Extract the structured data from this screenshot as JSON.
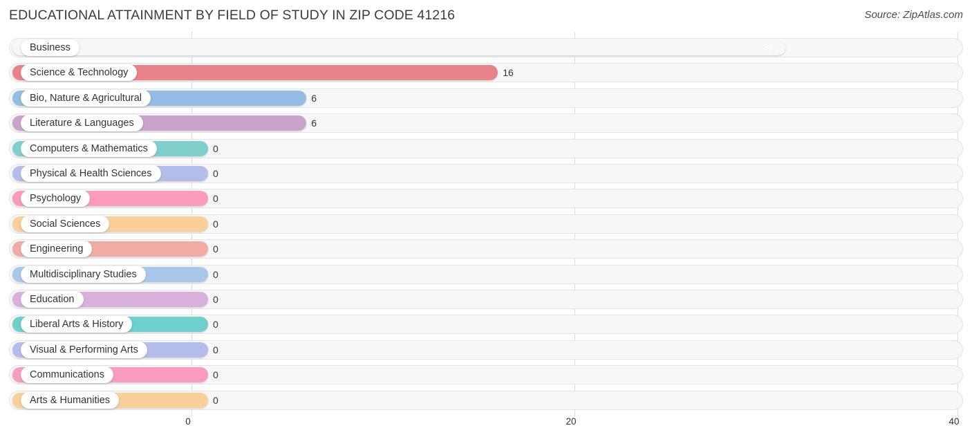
{
  "header": {
    "title": "EDUCATIONAL ATTAINMENT BY FIELD OF STUDY IN ZIP CODE 41216",
    "source": "Source: ZipAtlas.com"
  },
  "chart_data": {
    "type": "bar",
    "orientation": "horizontal",
    "title": "EDUCATIONAL ATTAINMENT BY FIELD OF STUDY IN ZIP CODE 41216",
    "xlabel": "",
    "ylabel": "",
    "xlim": [
      0,
      40
    ],
    "xticks": [
      0,
      20,
      40
    ],
    "xtick_labels": [
      "0",
      "20",
      "40"
    ],
    "grid": true,
    "legend": "none",
    "categories": [
      "Business",
      "Science & Technology",
      "Bio, Nature & Agricultural",
      "Literature & Languages",
      "Computers & Mathematics",
      "Physical & Health Sciences",
      "Psychology",
      "Social Sciences",
      "Engineering",
      "Multidisciplinary Studies",
      "Education",
      "Liberal Arts & History",
      "Visual & Performing Arts",
      "Communications",
      "Arts & Humanities"
    ],
    "values": [
      31,
      16,
      6,
      6,
      0,
      0,
      0,
      0,
      0,
      0,
      0,
      0,
      0,
      0,
      0
    ],
    "value_labels": [
      "31",
      "16",
      "6",
      "6",
      "0",
      "0",
      "0",
      "0",
      "0",
      "0",
      "0",
      "0",
      "0",
      "0",
      "0"
    ],
    "colors": [
      "#f5a košt",
      "#e8838a",
      "#93bde4",
      "#c9a4ca",
      "#7fd0cd",
      "#b4bdea",
      "#fa9cba",
      "#fbcf9a",
      "#f2aaa5",
      "#a8c8ea",
      "#d7b1db",
      "#6ecfcd",
      "#b4bcec",
      "#fa9cc0",
      "#fbcf9a"
    ]
  },
  "bars": [
    {
      "label": "Business",
      "value": 31,
      "value_label": "31",
      "color": "#f4a košt"
    },
    {
      "label": "Science & Technology",
      "value": 16,
      "value_label": "16",
      "color": "#e8838a"
    },
    {
      "label": "Bio, Nature & Agricultural",
      "value": 6,
      "value_label": "6",
      "color": "#93bde4"
    },
    {
      "label": "Literature & Languages",
      "value": 6,
      "value_label": "6",
      "color": "#c9a4ca"
    },
    {
      "label": "Computers & Mathematics",
      "value": 0,
      "value_label": "0",
      "color": "#7fd0cd"
    },
    {
      "label": "Physical & Health Sciences",
      "value": 0,
      "value_label": "0",
      "color": "#b4bdea"
    },
    {
      "label": "Psychology",
      "value": 0,
      "value_label": "0",
      "color": "#fa9cba"
    },
    {
      "label": "Social Sciences",
      "value": 0,
      "value_label": "0",
      "color": "#fbcf9a"
    },
    {
      "label": "Engineering",
      "value": 0,
      "value_label": "0",
      "color": "#f2aaa5"
    },
    {
      "label": "Multidisciplinary Studies",
      "value": 0,
      "value_label": "0",
      "color": "#a8c8ea"
    },
    {
      "label": "Education",
      "value": 0,
      "value_label": "0",
      "color": "#d7b1db"
    },
    {
      "label": "Liberal Arts & History",
      "value": 0,
      "value_label": "0",
      "color": "#6ecfcd"
    },
    {
      "label": "Visual & Performing Arts",
      "value": 0,
      "value_label": "0",
      "color": "#b4bcec"
    },
    {
      "label": "Communications",
      "value": 0,
      "value_label": "0",
      "color": "#fa9cc0"
    },
    {
      "label": "Arts & Humanities",
      "value": 0,
      "value_label": "0",
      "color": "#fbcf9a"
    }
  ],
  "axis": {
    "ticks": [
      "0",
      "20",
      "40"
    ]
  }
}
